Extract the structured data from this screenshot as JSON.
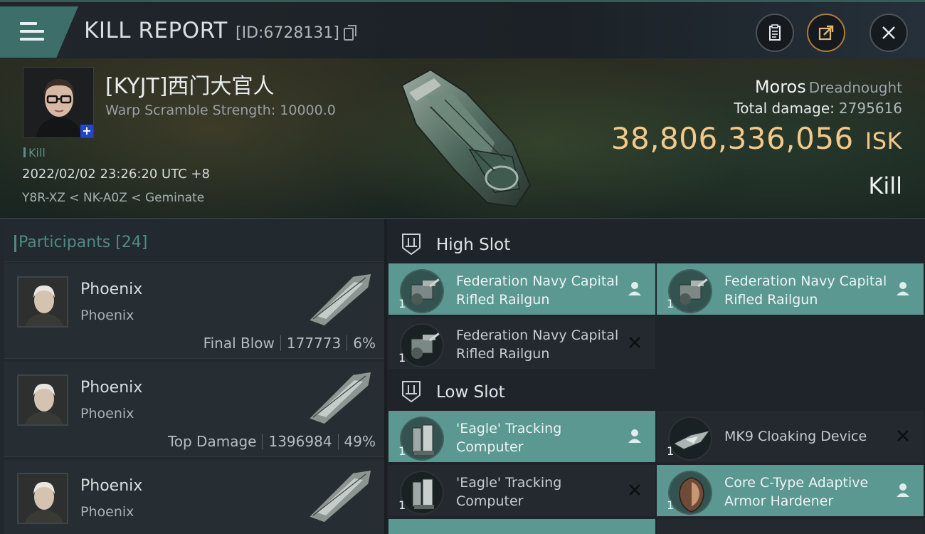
{
  "header": {
    "title": "KILL REPORT",
    "report_id": "[ID:6728131]",
    "buttons": {
      "clipboard": "clipboard-icon",
      "share": "share-icon",
      "close": "close-icon"
    }
  },
  "victim": {
    "name": "[KYJT]西门大官人",
    "warp_scramble": "Warp Scramble Strength: 10000.0",
    "tag": "Kill",
    "datetime": "2022/02/02 23:26:20 UTC +8",
    "location": "Y8R-XZ < NK-A0Z < Geminate",
    "ship_name": "Moros",
    "ship_class": "Dreadnought",
    "total_damage_label": "Total damage:",
    "total_damage_value": "2795616",
    "isk_value": "38,806,336,056",
    "isk_unit": "ISK",
    "result": "Kill"
  },
  "participants": {
    "label": "Participants [24]",
    "items": [
      {
        "name": "Phoenix",
        "ship": "Phoenix",
        "role": "Final Blow",
        "damage": "177773",
        "percent": "6%"
      },
      {
        "name": "Phoenix",
        "ship": "Phoenix",
        "role": "Top Damage",
        "damage": "1396984",
        "percent": "49%"
      },
      {
        "name": "Phoenix",
        "ship": "Phoenix",
        "role": "",
        "damage": "",
        "percent": ""
      }
    ]
  },
  "fitting": {
    "high_slot_label": "High Slot",
    "low_slot_label": "Low Slot",
    "high": [
      {
        "qty": "1",
        "name": "Federation Navy Capital Rifled Railgun",
        "state": "dropped"
      },
      {
        "qty": "1",
        "name": "Federation Navy Capital Rifled Railgun",
        "state": "dropped"
      },
      {
        "qty": "1",
        "name": "Federation Navy Capital Rifled Railgun",
        "state": "destroyed"
      }
    ],
    "low": [
      {
        "qty": "1",
        "name": "'Eagle' Tracking Computer",
        "state": "dropped"
      },
      {
        "qty": "1",
        "name": "MK9 Cloaking Device",
        "state": "destroyed"
      },
      {
        "qty": "1",
        "name": "'Eagle' Tracking Computer",
        "state": "destroyed"
      },
      {
        "qty": "1",
        "name": "Core C-Type Adaptive Armor Hardener",
        "state": "dropped"
      }
    ]
  },
  "colors": {
    "accent": "#5a9891",
    "isk": "#f1c98a",
    "participants_label": "#4f8a84"
  }
}
